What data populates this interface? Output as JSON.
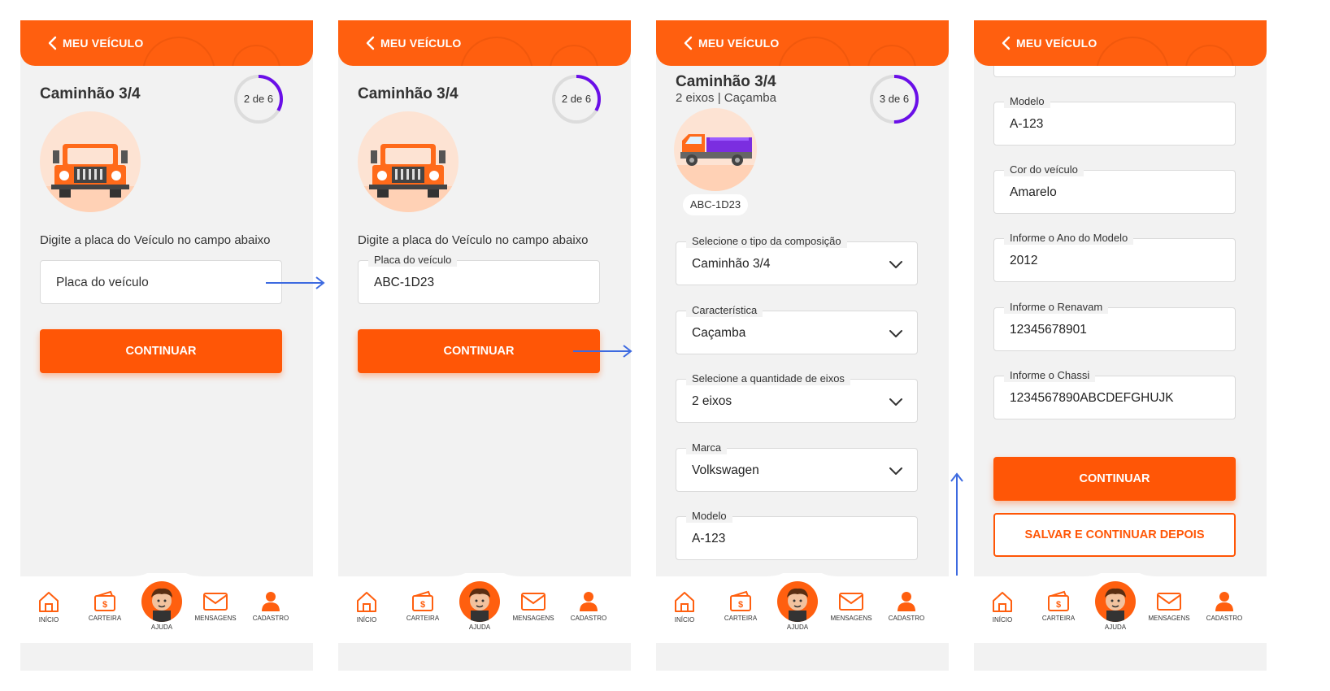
{
  "header": {
    "title": "MEU VEÍCULO"
  },
  "colors": {
    "brand": "#ff5f0f",
    "button": "#ff5606",
    "progress": "#6a0fe8",
    "arrow": "#3d6ae0"
  },
  "screens": [
    {
      "title": "Caminhão 3/4",
      "progress": {
        "label": "2 de 6",
        "fraction": 0.333
      },
      "instruction": "Digite a placa do Veículo no campo abaixo",
      "plate_field": {
        "placeholder": "Placa do veículo"
      },
      "continue_label": "CONTINUAR"
    },
    {
      "title": "Caminhão 3/4",
      "progress": {
        "label": "2 de 6",
        "fraction": 0.333
      },
      "instruction": "Digite a placa do Veículo no campo abaixo",
      "plate_field": {
        "label": "Placa do veículo",
        "value": "ABC-1D23"
      },
      "continue_label": "CONTINUAR"
    },
    {
      "title": "Caminhão 3/4",
      "subtitle": "2 eixos | Caçamba",
      "progress": {
        "label": "3 de 6",
        "fraction": 0.5
      },
      "plate": "ABC-1D23",
      "fields": [
        {
          "label": "Selecione o tipo da composição",
          "value": "Caminhão 3/4",
          "type": "select"
        },
        {
          "label": "Característica",
          "value": "Caçamba",
          "type": "select"
        },
        {
          "label": "Selecione a quantidade de eixos",
          "value": "2 eixos",
          "type": "select"
        },
        {
          "label": "Marca",
          "value": "Volkswagen",
          "type": "select"
        },
        {
          "label": "Modelo",
          "value": "A-123",
          "type": "text"
        }
      ]
    },
    {
      "fields": [
        {
          "label": "Modelo",
          "value": "A-123"
        },
        {
          "label": "Cor do veículo",
          "value": "Amarelo"
        },
        {
          "label": "Informe o Ano do Modelo",
          "value": "2012"
        },
        {
          "label": "Informe o Renavam",
          "value": "12345678901"
        },
        {
          "label": "Informe o Chassi",
          "value": "1234567890ABCDEFGHUJK"
        }
      ],
      "continue_label": "CONTINUAR",
      "save_label": "SALVAR E CONTINUAR DEPOIS"
    }
  ],
  "nav": {
    "inicio": "INÍCIO",
    "carteira": "CARTEIRA",
    "ajuda": "AJUDA",
    "mensagens": "MENSAGENS",
    "cadastro": "CADASTRO"
  }
}
